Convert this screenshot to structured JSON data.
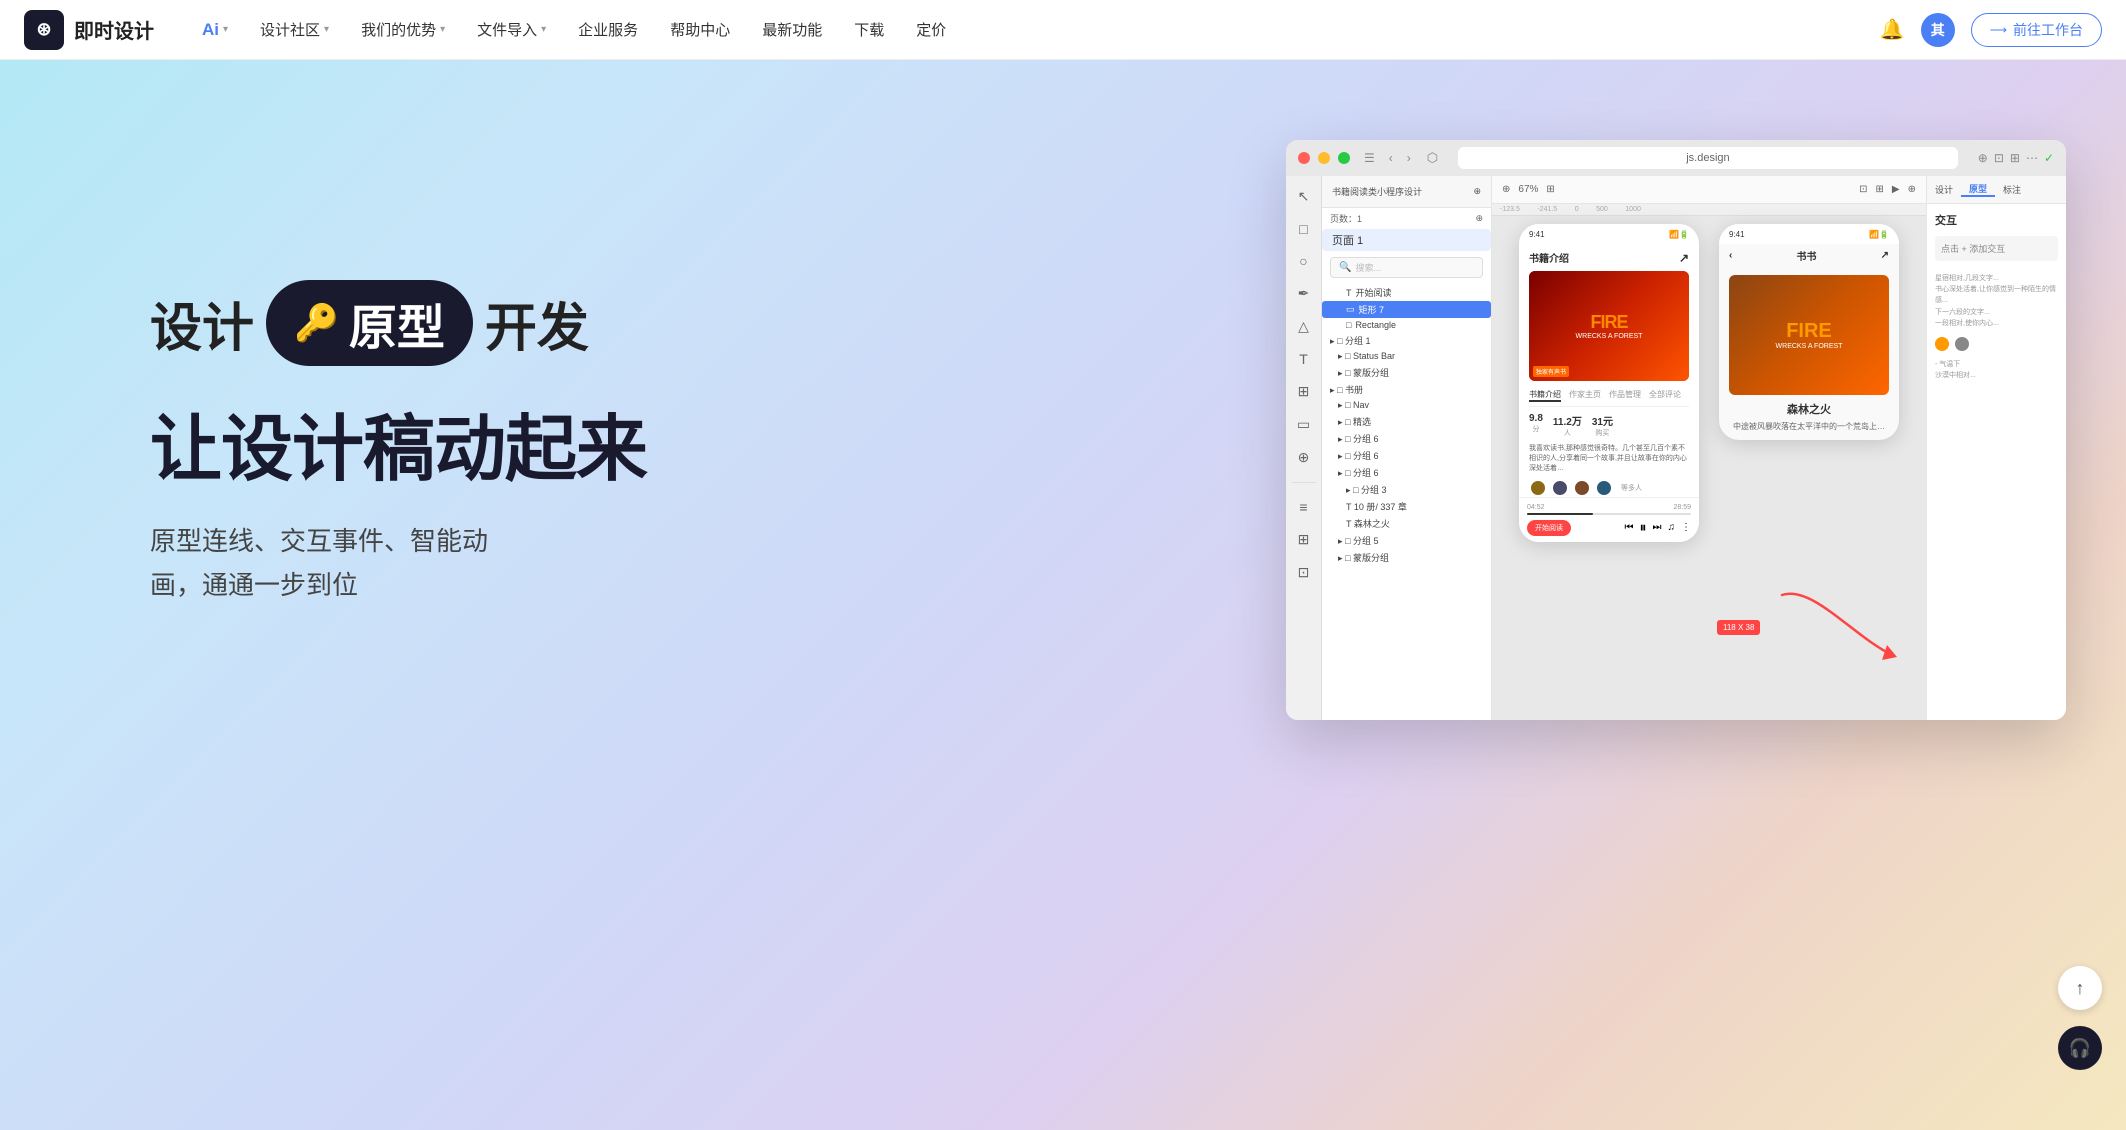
{
  "brand": {
    "logo_icon": "⊛",
    "logo_text": "即时设计"
  },
  "nav": {
    "items": [
      {
        "label": "Ai",
        "has_chevron": true,
        "active": true
      },
      {
        "label": "设计社区",
        "has_chevron": true,
        "active": false
      },
      {
        "label": "我们的优势",
        "has_chevron": true,
        "active": false
      },
      {
        "label": "文件导入",
        "has_chevron": true,
        "active": false
      },
      {
        "label": "企业服务",
        "has_chevron": false,
        "active": false
      },
      {
        "label": "帮助中心",
        "has_chevron": false,
        "active": false
      },
      {
        "label": "最新功能",
        "has_chevron": false,
        "active": false
      },
      {
        "label": "下载",
        "has_chevron": false,
        "active": false
      },
      {
        "label": "定价",
        "has_chevron": false,
        "active": false
      }
    ],
    "cta_avatar": "其",
    "cta_label": "前往工作台"
  },
  "hero": {
    "badge_prefix": "设计",
    "badge_text": "原型",
    "badge_suffix": "开发",
    "title": "让设计稿动起来",
    "description": "原型连线、交互事件、智能动\n画，通通一步到位"
  },
  "window": {
    "url": "js.design",
    "tab_label": "书籍阅读类小程序设计",
    "zoom": "67%",
    "page_label": "页数：1",
    "page_name": "页面 1",
    "layers": [
      {
        "label": "T 开始阅读",
        "indent": 2,
        "icon": "T"
      },
      {
        "label": "⬡ 矩形7",
        "indent": 2,
        "icon": "▭",
        "selected": true
      },
      {
        "label": "Rectangle",
        "indent": 2,
        "icon": "□"
      },
      {
        "label": "□ 分组 1",
        "indent": 1,
        "icon": "□"
      },
      {
        "label": "□ Status Bar",
        "indent": 2,
        "icon": "□"
      },
      {
        "label": "□ 蒙版分组",
        "indent": 2,
        "icon": "□"
      },
      {
        "label": "□ 书册",
        "indent": 1,
        "icon": "□"
      },
      {
        "label": "□ Nav",
        "indent": 2,
        "icon": "□"
      },
      {
        "label": "□ 精选",
        "indent": 2,
        "icon": "□"
      },
      {
        "label": "□ 分组 6",
        "indent": 2,
        "icon": "□"
      },
      {
        "label": "□ 分组 6",
        "indent": 2,
        "icon": "□"
      },
      {
        "label": "□ 分组 6",
        "indent": 2,
        "icon": "□"
      },
      {
        "label": "□ 分组 3",
        "indent": 3,
        "icon": "□"
      },
      {
        "label": "T 10 册/ 337 章",
        "indent": 3,
        "icon": "T"
      },
      {
        "label": "T 森林之火",
        "indent": 3,
        "icon": "T"
      },
      {
        "label": "□ 分组 5",
        "indent": 2,
        "icon": "□"
      },
      {
        "label": "□ 蒙版分组",
        "indent": 2,
        "icon": "□"
      }
    ],
    "props_tabs": [
      "设计",
      "原型",
      "标注"
    ],
    "active_props_tab": "原型",
    "interaction_label": "交互",
    "phone1": {
      "time": "9:41",
      "title": "书籍介绍",
      "book_title": "森林之火",
      "rating": "9.8",
      "chapters": "11.2万",
      "price": "31元",
      "tabs": [
        "书籍介绍",
        "作家主页",
        "作品管理",
        "全部评论"
      ],
      "desc": "我喜欢读书,那种感觉很奇特。几个甚至几百个素不相识的人,分享着同一个故事,并且让故事在你的内心深处活着,让你感觉到一种陌生的情感",
      "listener_count": 4,
      "play_time_start": "04:52",
      "play_time_end": "28:59",
      "cta_label": "开始阅读"
    },
    "phone2": {
      "time": "9:41",
      "title": "书书",
      "book_title": "森林之火",
      "author_intro": "中途被风暴吹落在太平洋中的一个荒岛上…",
      "side_text": "星宿相对,几段文字..."
    },
    "tooltip": "118 X 38",
    "arrow_color": "#ff4444"
  },
  "scroll": {
    "up_icon": "↑",
    "help_icon": "🎧"
  }
}
